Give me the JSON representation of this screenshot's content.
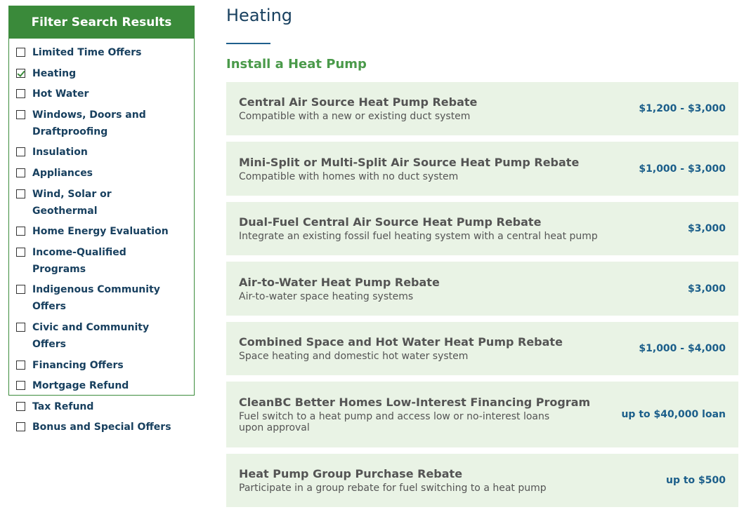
{
  "filter": {
    "title": "Filter Search Results",
    "items": [
      {
        "label": "Limited Time Offers",
        "checked": false
      },
      {
        "label": "Heating",
        "checked": true
      },
      {
        "label": "Hot Water",
        "checked": false
      },
      {
        "label": "Windows, Doors and Draftproofing",
        "checked": false
      },
      {
        "label": "Insulation",
        "checked": false
      },
      {
        "label": "Appliances",
        "checked": false
      },
      {
        "label": "Wind, Solar or Geothermal",
        "checked": false
      },
      {
        "label": "Home Energy Evaluation",
        "checked": false
      },
      {
        "label": "Income-Qualified Programs",
        "checked": false
      },
      {
        "label": "Indigenous Community Offers",
        "checked": false
      },
      {
        "label": "Civic and Community Offers",
        "checked": false
      },
      {
        "label": "Financing Offers",
        "checked": false
      },
      {
        "label": "Mortgage Refund",
        "checked": false
      },
      {
        "label": "Tax Refund",
        "checked": false
      },
      {
        "label": "Bonus and Special Offers",
        "checked": false
      }
    ]
  },
  "main": {
    "title": "Heating",
    "section_title": "Install a Heat Pump",
    "offers": [
      {
        "title": "Central Air Source Heat Pump Rebate",
        "desc": "Compatible with a new or existing duct system",
        "price": "$1,200 - $3,000"
      },
      {
        "title": "Mini-Split or Multi-Split Air Source Heat Pump Rebate",
        "desc": "Compatible with homes with no duct system",
        "price": "$1,000 - $3,000"
      },
      {
        "title": "Dual-Fuel Central Air Source Heat Pump Rebate",
        "desc": "Integrate an existing fossil fuel heating system with a central heat pump",
        "price": "$3,000"
      },
      {
        "title": "Air-to-Water Heat Pump Rebate",
        "desc": "Air-to-water space heating systems",
        "price": "$3,000"
      },
      {
        "title": "Combined Space and Hot Water Heat Pump Rebate",
        "desc": "Space heating and domestic hot water system",
        "price": "$1,000 - $4,000"
      },
      {
        "title": "CleanBC Better Homes Low-Interest Financing Program",
        "desc": "Fuel switch to a heat pump and access low or no-interest loans upon approval",
        "price": "up to $40,000 loan"
      },
      {
        "title": "Heat Pump Group Purchase Rebate",
        "desc": "Participate in a group rebate for fuel switching to a heat pump",
        "price": "up to $500"
      }
    ]
  }
}
